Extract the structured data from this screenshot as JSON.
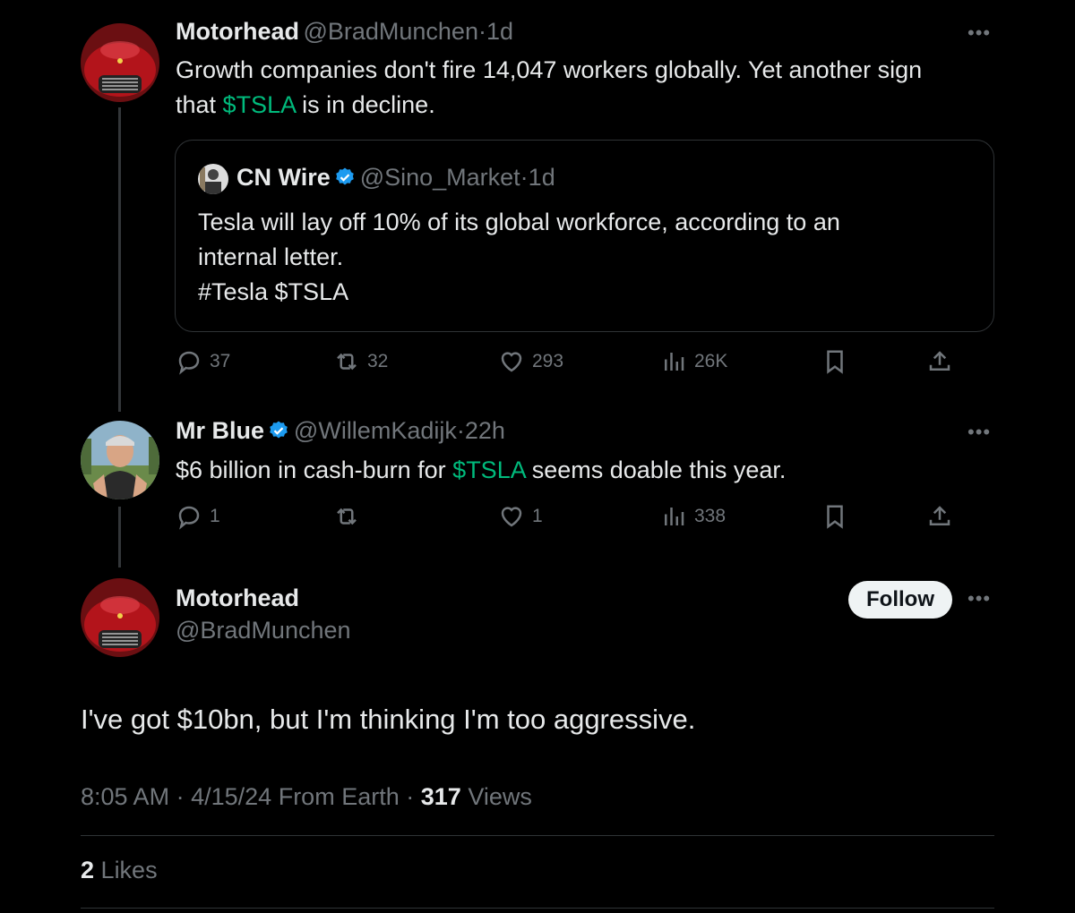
{
  "tweet1": {
    "name": "Motorhead",
    "handle": "@BradMunchen",
    "time": "1d",
    "text_line1": "Growth companies don't fire 14,047 workers globally. Yet another sign",
    "text_line2_pre": "that ",
    "text_cashtag": "$TSLA",
    "text_line2_post": " is in decline.",
    "quote": {
      "name": "CN Wire",
      "handle": "@Sino_Market",
      "time": "1d",
      "line1": "Tesla will lay off 10% of its global workforce, according to an",
      "line2": "internal letter.",
      "line3": "#Tesla $TSLA"
    },
    "actions": {
      "replies": "37",
      "reposts": "32",
      "likes": "293",
      "views": "26K"
    }
  },
  "tweet2": {
    "name": "Mr Blue",
    "handle": "@WillemKadijk",
    "time": "22h",
    "text_pre": "$6 billion in cash-burn for ",
    "text_cashtag": "$TSLA",
    "text_post": " seems doable this year.",
    "actions": {
      "replies": "1",
      "reposts": "",
      "likes": "1",
      "views": "338"
    }
  },
  "main": {
    "name": "Motorhead",
    "handle": "@BradMunchen",
    "follow_label": "Follow",
    "text": "I've got $10bn, but I'm thinking I'm too aggressive.",
    "time": "8:05 AM",
    "date": "4/15/24",
    "source": "From Earth",
    "views_count": "317",
    "views_label": "Views",
    "likes_count": "2",
    "likes_label": "Likes"
  },
  "separator": "·",
  "colors": {
    "link_green": "#00ba7c",
    "verified_blue": "#1d9bf0",
    "muted": "#71767b"
  },
  "icons": [
    "reply-icon",
    "repost-icon",
    "like-icon",
    "views-icon",
    "bookmark-icon",
    "share-icon",
    "more-icon",
    "verified-icon"
  ]
}
